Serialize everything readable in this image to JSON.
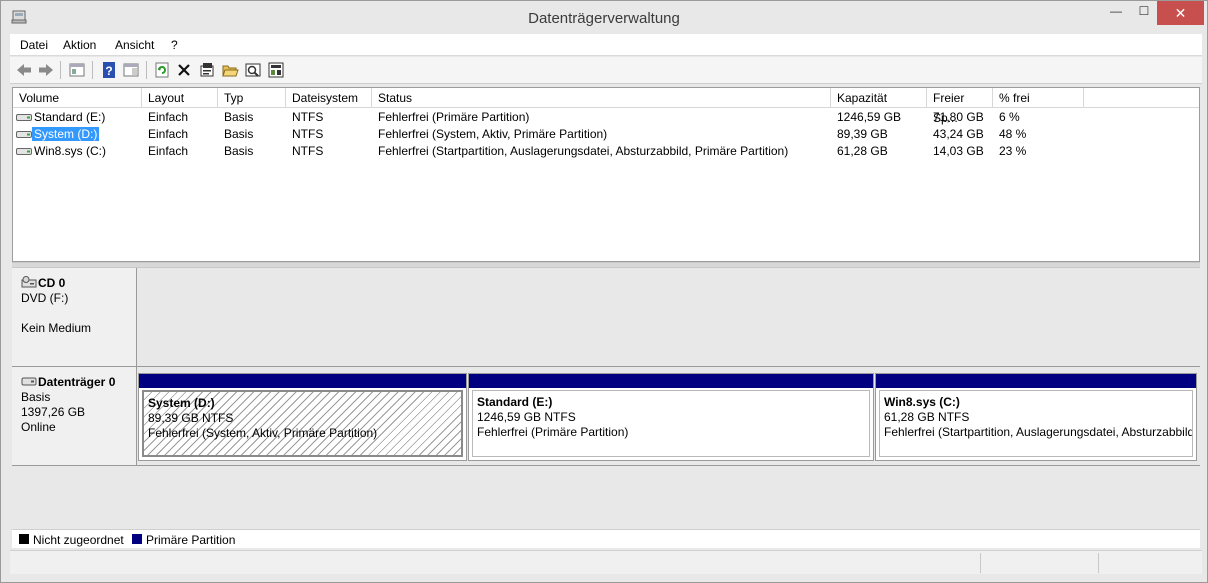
{
  "window": {
    "title": "Datenträgerverwaltung",
    "min": "—",
    "max": "☐",
    "close": "✕"
  },
  "menu": [
    "Datei",
    "Aktion",
    "Ansicht",
    "?"
  ],
  "toolbar": [
    "back-icon",
    "forward-icon",
    "console-tree-icon",
    "help-icon",
    "properties-pane-icon",
    "refresh-icon",
    "delete-icon",
    "properties-icon",
    "open-icon",
    "explore-icon",
    "settings-icon"
  ],
  "volume_list": {
    "columns": [
      "Volume",
      "Layout",
      "Typ",
      "Dateisystem",
      "Status",
      "Kapazität",
      "Freier Sp...",
      "% frei"
    ],
    "rows": [
      {
        "volume": "Standard (E:)",
        "layout": "Einfach",
        "typ": "Basis",
        "fs": "NTFS",
        "status": "Fehlerfrei (Primäre Partition)",
        "kap": "1246,59 GB",
        "frei": "71,80 GB",
        "pct": "6 %"
      },
      {
        "volume": "System (D:)",
        "layout": "Einfach",
        "typ": "Basis",
        "fs": "NTFS",
        "status": "Fehlerfrei (System, Aktiv, Primäre Partition)",
        "kap": "89,39 GB",
        "frei": "43,24 GB",
        "pct": "48 %"
      },
      {
        "volume": "Win8.sys (C:)",
        "layout": "Einfach",
        "typ": "Basis",
        "fs": "NTFS",
        "status": "Fehlerfrei (Startpartition, Auslagerungsdatei, Absturzabbild, Primäre Partition)",
        "kap": "61,28 GB",
        "frei": "14,03 GB",
        "pct": "23 %"
      }
    ]
  },
  "disks": {
    "cd": {
      "name": "CD 0",
      "type": "DVD (F:)",
      "media": "Kein Medium"
    },
    "disk0": {
      "name": "Datenträger 0",
      "type": "Basis",
      "size": "1397,26 GB",
      "state": "Online",
      "partitions": [
        {
          "name": "System  (D:)",
          "size": "89,39 GB NTFS",
          "status": "Fehlerfrei (System, Aktiv, Primäre Partition)"
        },
        {
          "name": "Standard  (E:)",
          "size": "1246,59 GB NTFS",
          "status": "Fehlerfrei (Primäre Partition)"
        },
        {
          "name": "Win8.sys  (C:)",
          "size": "61,28 GB NTFS",
          "status": "Fehlerfrei (Startpartition, Auslagerungsdatei, Absturzabbild"
        }
      ]
    }
  },
  "legend": [
    {
      "label": "Nicht zugeordnet",
      "color": "#000000"
    },
    {
      "label": "Primäre Partition",
      "color": "#000080"
    }
  ]
}
